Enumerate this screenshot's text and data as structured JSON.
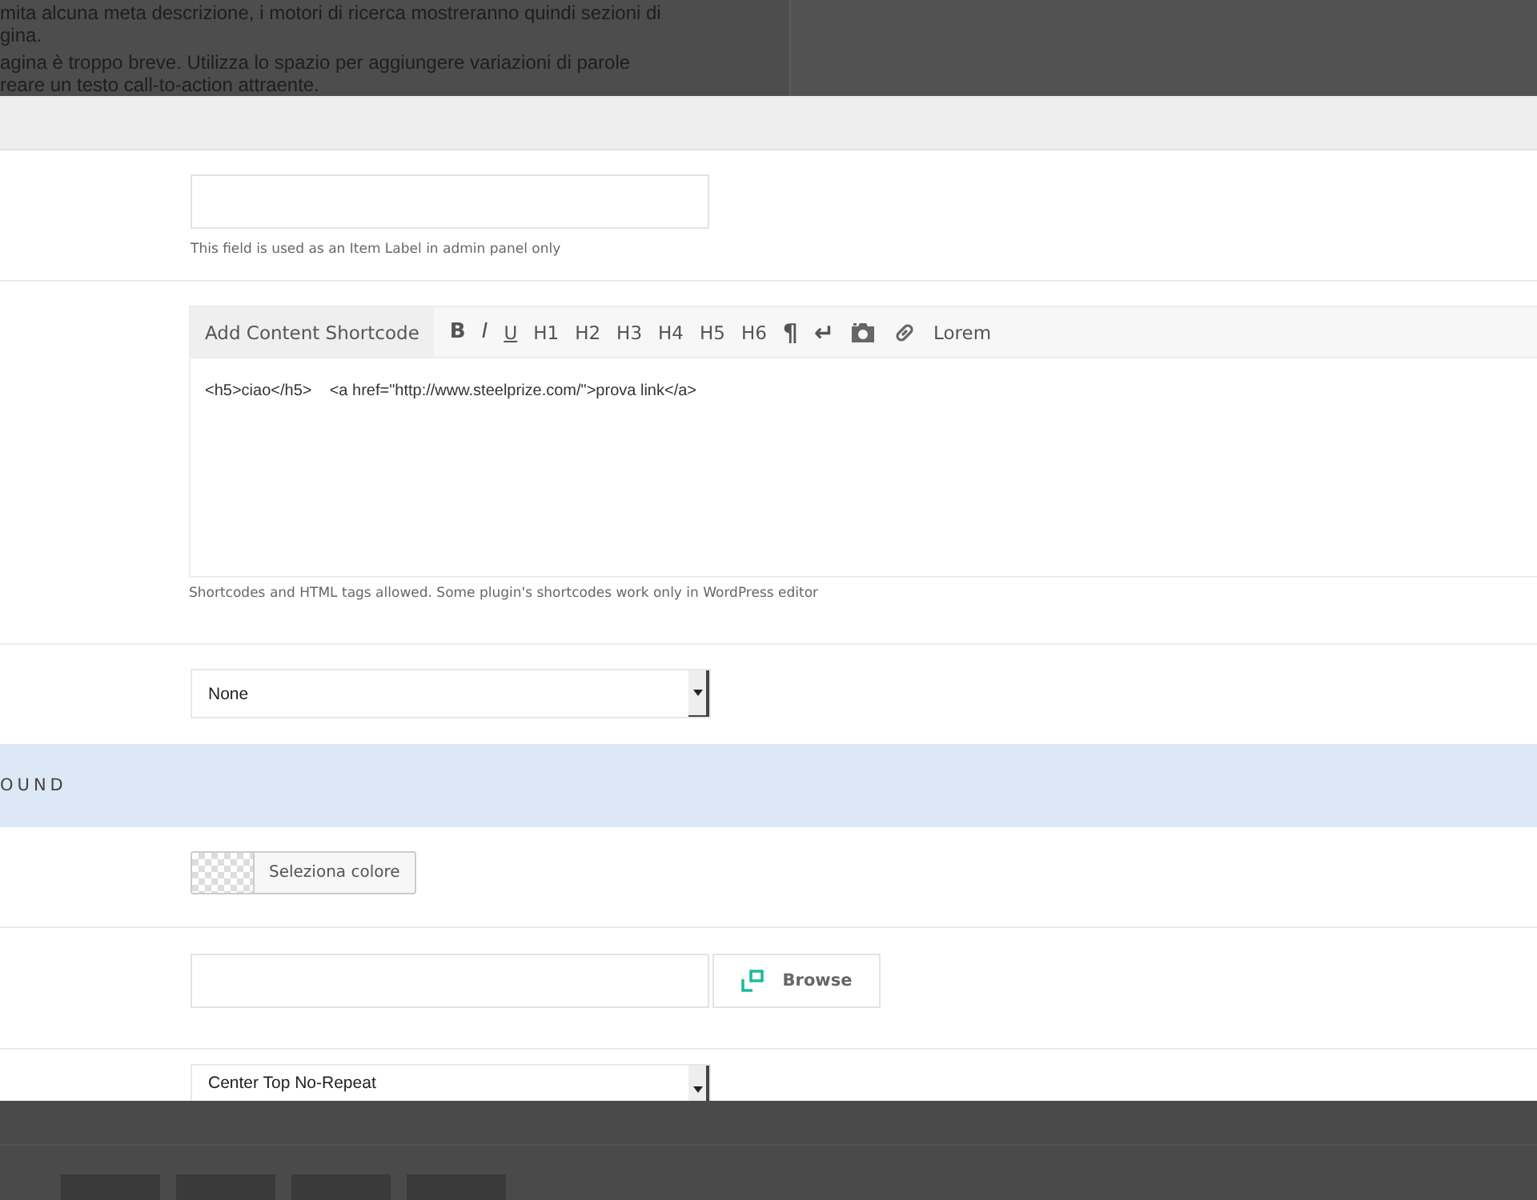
{
  "background_text": [
    "mita alcuna meta descrizione, i motori di ricerca mostreranno quindi sezioni di",
    "gina.",
    "agina è troppo breve. Utilizza lo spazio per aggiungere variazioni di parole",
    "reare un testo call-to-action attraente."
  ],
  "item_label_field": {
    "help": "This field is used as an Item Label in admin panel only"
  },
  "editor": {
    "shortcode_button": "Add Content Shortcode",
    "toolbar": [
      {
        "kind": "bold",
        "label": "B"
      },
      {
        "kind": "italic",
        "label": "I"
      },
      {
        "kind": "underline",
        "label": "U"
      },
      {
        "kind": "text",
        "label": "H1"
      },
      {
        "kind": "text",
        "label": "H2"
      },
      {
        "kind": "text",
        "label": "H3"
      },
      {
        "kind": "text",
        "label": "H4"
      },
      {
        "kind": "text",
        "label": "H5"
      },
      {
        "kind": "text",
        "label": "H6"
      },
      {
        "kind": "glyph",
        "label": "¶"
      },
      {
        "kind": "glyph",
        "label": "↵"
      },
      {
        "kind": "image"
      },
      {
        "kind": "link"
      },
      {
        "kind": "text",
        "label": "Lorem"
      }
    ],
    "content": "<h5>ciao</h5>    <a href=\"http://www.steelprize.com/\">prova link</a>",
    "help": "Shortcodes and HTML tags allowed. Some plugin's shortcodes work only in WordPress editor"
  },
  "select_1": {
    "value": "None"
  },
  "section_header": "OUND",
  "color_button": "Seleziona colore",
  "browse": {
    "button": "Browse"
  },
  "select_2": {
    "value": "Center Top No-Repeat"
  }
}
